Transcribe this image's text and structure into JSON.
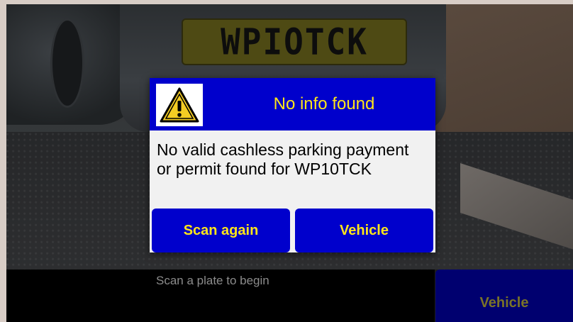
{
  "scene": {
    "plate_text": "WPIOTCK"
  },
  "status": {
    "text": "Scan a plate to begin"
  },
  "background_buttons": {
    "vehicle_label": "Vehicle"
  },
  "dialog": {
    "icon": "warning-triangle-icon",
    "title": "No info found",
    "message": "No valid cashless parking payment or permit found for WP10TCK",
    "buttons": {
      "scan_again": "Scan again",
      "vehicle": "Vehicle"
    }
  },
  "colors": {
    "dialog_header": "#0000cc",
    "accent_text": "#ffe619",
    "dialog_body": "#f1f1f1",
    "background_button": "#00006f"
  }
}
